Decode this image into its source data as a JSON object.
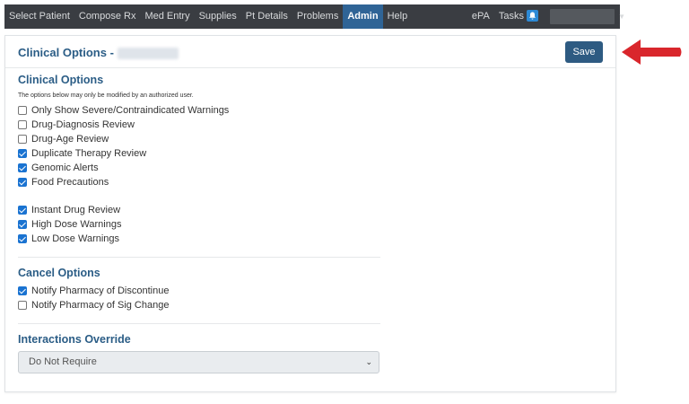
{
  "nav": {
    "items": [
      {
        "label": "Select Patient",
        "name": "nav-select-patient",
        "active": false
      },
      {
        "label": "Compose Rx",
        "name": "nav-compose-rx",
        "active": false
      },
      {
        "label": "Med Entry",
        "name": "nav-med-entry",
        "active": false
      },
      {
        "label": "Supplies",
        "name": "nav-supplies",
        "active": false
      },
      {
        "label": "Pt Details",
        "name": "nav-pt-details",
        "active": false
      },
      {
        "label": "Problems",
        "name": "nav-problems",
        "active": false
      },
      {
        "label": "Admin",
        "name": "nav-admin",
        "active": true
      },
      {
        "label": "Help",
        "name": "nav-help",
        "active": false
      }
    ],
    "epa_label": "ePA",
    "tasks_label": "Tasks"
  },
  "header": {
    "title": "Clinical Options -",
    "save_label": "Save"
  },
  "clinical": {
    "title": "Clinical Options",
    "note": "The options below may only be modified by an authorized user.",
    "group1": [
      {
        "label": "Only Show Severe/Contraindicated Warnings",
        "checked": false
      },
      {
        "label": "Drug-Diagnosis Review",
        "checked": false
      },
      {
        "label": "Drug-Age Review",
        "checked": false
      },
      {
        "label": "Duplicate Therapy Review",
        "checked": true
      },
      {
        "label": "Genomic Alerts",
        "checked": true
      },
      {
        "label": "Food Precautions",
        "checked": true
      }
    ],
    "group2": [
      {
        "label": "Instant Drug Review",
        "checked": true
      },
      {
        "label": "High Dose Warnings",
        "checked": true
      },
      {
        "label": "Low Dose Warnings",
        "checked": true
      }
    ]
  },
  "cancel": {
    "title": "Cancel Options",
    "options": [
      {
        "label": "Notify Pharmacy of Discontinue",
        "checked": true
      },
      {
        "label": "Notify Pharmacy of Sig Change",
        "checked": false
      }
    ]
  },
  "interactions": {
    "title": "Interactions Override",
    "selected": "Do Not Require"
  },
  "colors": {
    "navbar": "#3a3d42",
    "active_tab": "#2f6496",
    "accent": "#2b5d86",
    "checkbox": "#1a73d1",
    "arrow": "#d9262c"
  }
}
